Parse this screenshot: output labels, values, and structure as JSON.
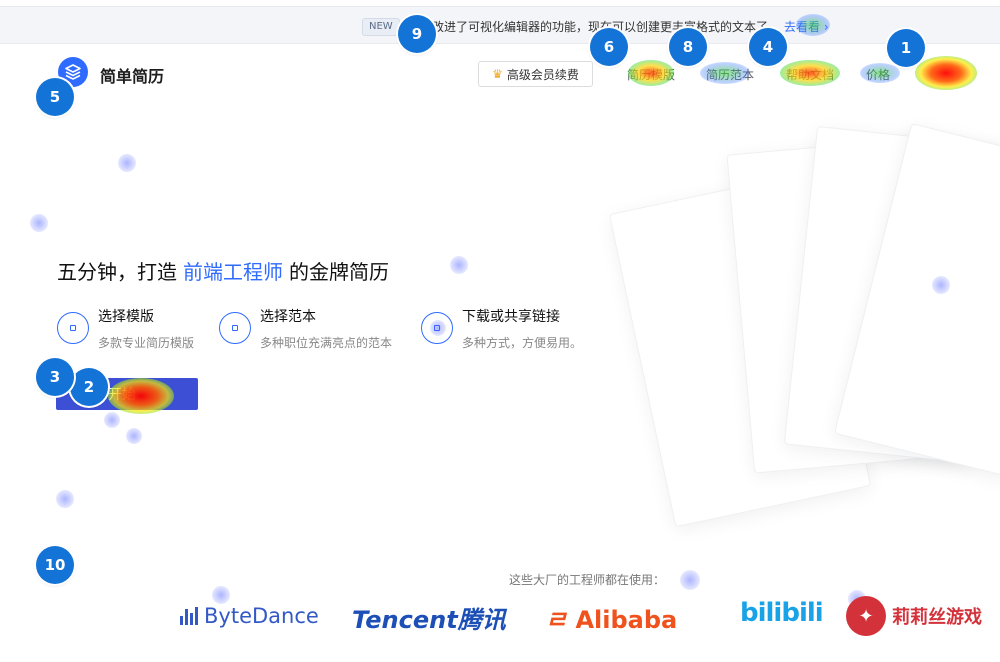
{
  "announcement": {
    "tag": "NEW",
    "message": "们改进了可视化编辑器的功能，现在可以创建更丰富格式的文本了",
    "link": "去看看"
  },
  "header": {
    "logo_text": "简单简历",
    "vip_label": "高级会员续费",
    "nav": [
      "简历模版",
      "简历范本",
      "帮助文档",
      "价格"
    ]
  },
  "hero": {
    "title_before": "五分钟，打造",
    "title_highlight": "前端工程师",
    "title_after": "的金牌简历",
    "features": [
      {
        "title": "选择模版",
        "desc": "多款专业简历模版"
      },
      {
        "title": "选择范本",
        "desc": "多种职位充满亮点的范本"
      },
      {
        "title": "下载或共享链接",
        "desc": "多种方式，方便易用。"
      }
    ],
    "start_label": "开始"
  },
  "companies": {
    "label": "这些大厂的工程师都在使用：",
    "brands": [
      "ByteDance",
      "Tencent腾讯",
      "Alibaba",
      "bilibili",
      "莉莉丝游戏"
    ]
  },
  "markers": [
    "1",
    "2",
    "3",
    "4",
    "5",
    "6",
    "8",
    "9",
    "10"
  ],
  "colors": {
    "accent": "#2f6bff",
    "button": "#3d4fd4",
    "marker": "#1473d6"
  }
}
